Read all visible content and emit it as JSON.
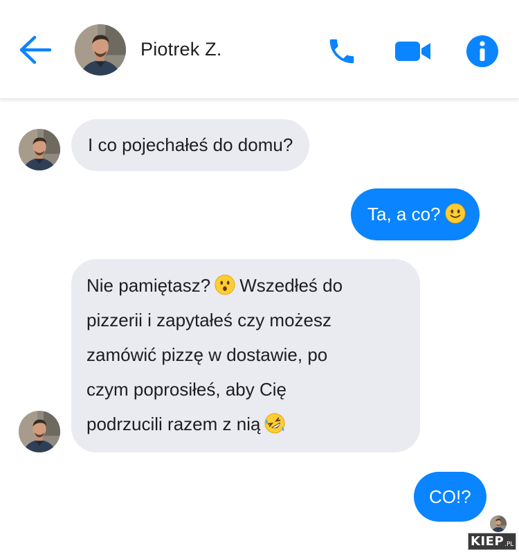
{
  "header": {
    "contact_name": "Piotrek Z.",
    "back_icon": "arrow-left-icon",
    "call_icon": "phone-icon",
    "video_icon": "video-camera-icon",
    "info_icon": "info-icon"
  },
  "messages": [
    {
      "sender": "contact",
      "lines": [
        "I co pojechałeś do domu?"
      ]
    },
    {
      "sender": "me",
      "lines": [
        "Ta, a co?"
      ],
      "emoji": "slightly-smiling-face"
    },
    {
      "sender": "contact",
      "lines": [
        "Nie pamiętasz?",
        "pizzerii i zapytałeś czy możesz",
        "zamówić pizzę w dostawie, po",
        "czym poprosiłeś, aby Cię",
        "podrzucili razem z nią"
      ],
      "line1_suffix": "Wszedłeś do",
      "emojis": [
        "hushed-face",
        "rolling-on-floor-laughing"
      ]
    },
    {
      "sender": "me",
      "lines": [
        "CO!?"
      ]
    }
  ],
  "watermark": {
    "main": "KIEP",
    "suffix": ".PL"
  },
  "colors": {
    "accent": "#0a84ff",
    "incoming_bubble": "#e9ebf0",
    "outgoing_bubble": "#0a84ff",
    "text": "#1c1e21"
  }
}
